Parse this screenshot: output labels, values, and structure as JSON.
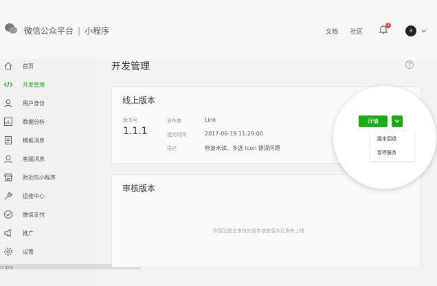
{
  "header": {
    "brand": "微信公众平台",
    "separator": "|",
    "product": "小程序",
    "docs_link": "文档",
    "community_link": "社区",
    "notification_count": "2",
    "avatar_initial": "∂"
  },
  "sidebar": {
    "items": [
      {
        "label": "首页",
        "icon": "home-icon"
      },
      {
        "label": "开发管理",
        "icon": "code-icon",
        "active": true
      },
      {
        "label": "用户身份",
        "icon": "user-icon"
      },
      {
        "label": "数据分析",
        "icon": "chart-icon"
      },
      {
        "label": "模板消息",
        "icon": "document-icon"
      },
      {
        "label": "客服消息",
        "icon": "support-icon"
      },
      {
        "label": "附近的小程序",
        "icon": "store-icon"
      },
      {
        "label": "运维中心",
        "icon": "wrench-icon"
      },
      {
        "label": "微信支付",
        "icon": "payment-icon"
      },
      {
        "label": "推广",
        "icon": "megaphone-icon"
      },
      {
        "label": "设置",
        "icon": "gear-icon"
      }
    ],
    "scripts_text": "cripts"
  },
  "main": {
    "title": "开发管理",
    "online_card": {
      "title": "线上版本",
      "version_label": "版本号",
      "version": "1.1.1",
      "publisher_label": "发布者",
      "publisher": "Link",
      "time_label": "提交时间",
      "time": "2017-06-19 11:29:00",
      "desc_label": "描述",
      "desc": "修复未读、多选 Icon 错误问题",
      "detail_button": "详情",
      "menu": [
        "版本回退",
        "暂停服务"
      ]
    },
    "review_card": {
      "title": "审核版本",
      "empty_text": "你暂无提交审核的版本或者版本已发布上线"
    }
  },
  "colors": {
    "accent": "#1aad19",
    "badge": "#e64340"
  }
}
